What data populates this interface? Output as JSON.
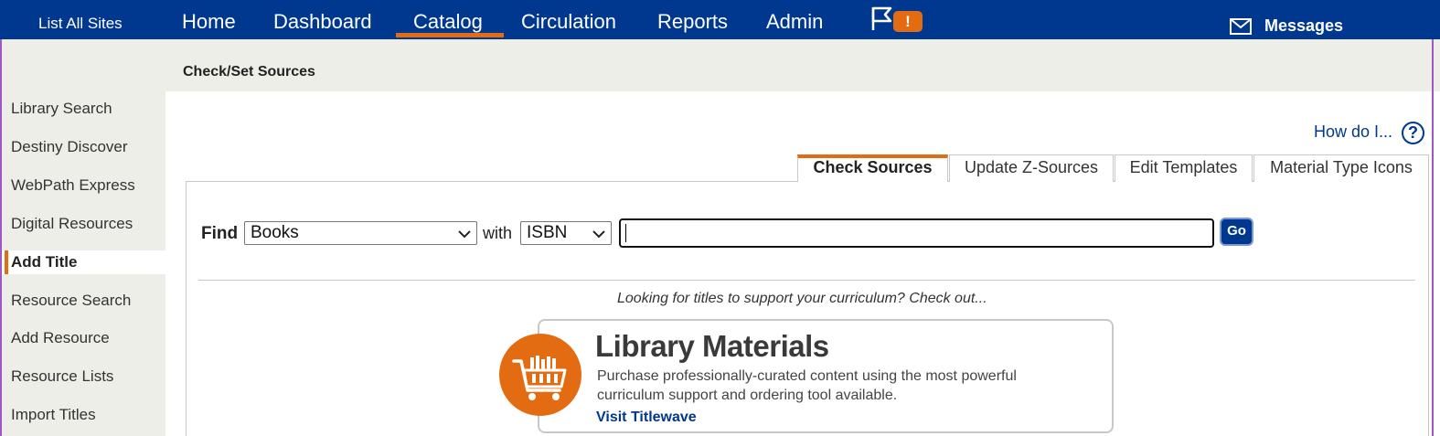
{
  "header": {
    "site_link": "List All Sites",
    "nav": [
      "Home",
      "Dashboard",
      "Catalog",
      "Circulation",
      "Reports",
      "Admin"
    ],
    "active_nav": "Catalog",
    "alert_badge": "!",
    "messages_label": "Messages"
  },
  "breadcrumb": {
    "page_title": "Check/Set Sources"
  },
  "sidebar": {
    "items": [
      "Library Search",
      "Destiny Discover",
      "WebPath Express",
      "Digital Resources",
      "Add Title",
      "Resource Search",
      "Add Resource",
      "Resource Lists",
      "Import Titles"
    ],
    "active": "Add Title"
  },
  "help": {
    "label": "How do I...",
    "icon_text": "?"
  },
  "tabs": [
    "Check Sources",
    "Update Z-Sources",
    "Edit Templates",
    "Material Type Icons"
  ],
  "search": {
    "find_label": "Find",
    "type_value": "Books",
    "with_label": "with",
    "field_value": "ISBN",
    "query_value": "",
    "go_label": "Go"
  },
  "promo": {
    "intro": "Looking for titles to support your curriculum? Check out...",
    "heading": "Library Materials",
    "description": "Purchase professionally-curated content using the most powerful curriculum support and ordering tool available.",
    "link": "Visit Titlewave"
  },
  "colors": {
    "brand_blue": "#00388f",
    "accent_orange": "#e36c12",
    "sidebar_bg": "#eeeee9"
  }
}
